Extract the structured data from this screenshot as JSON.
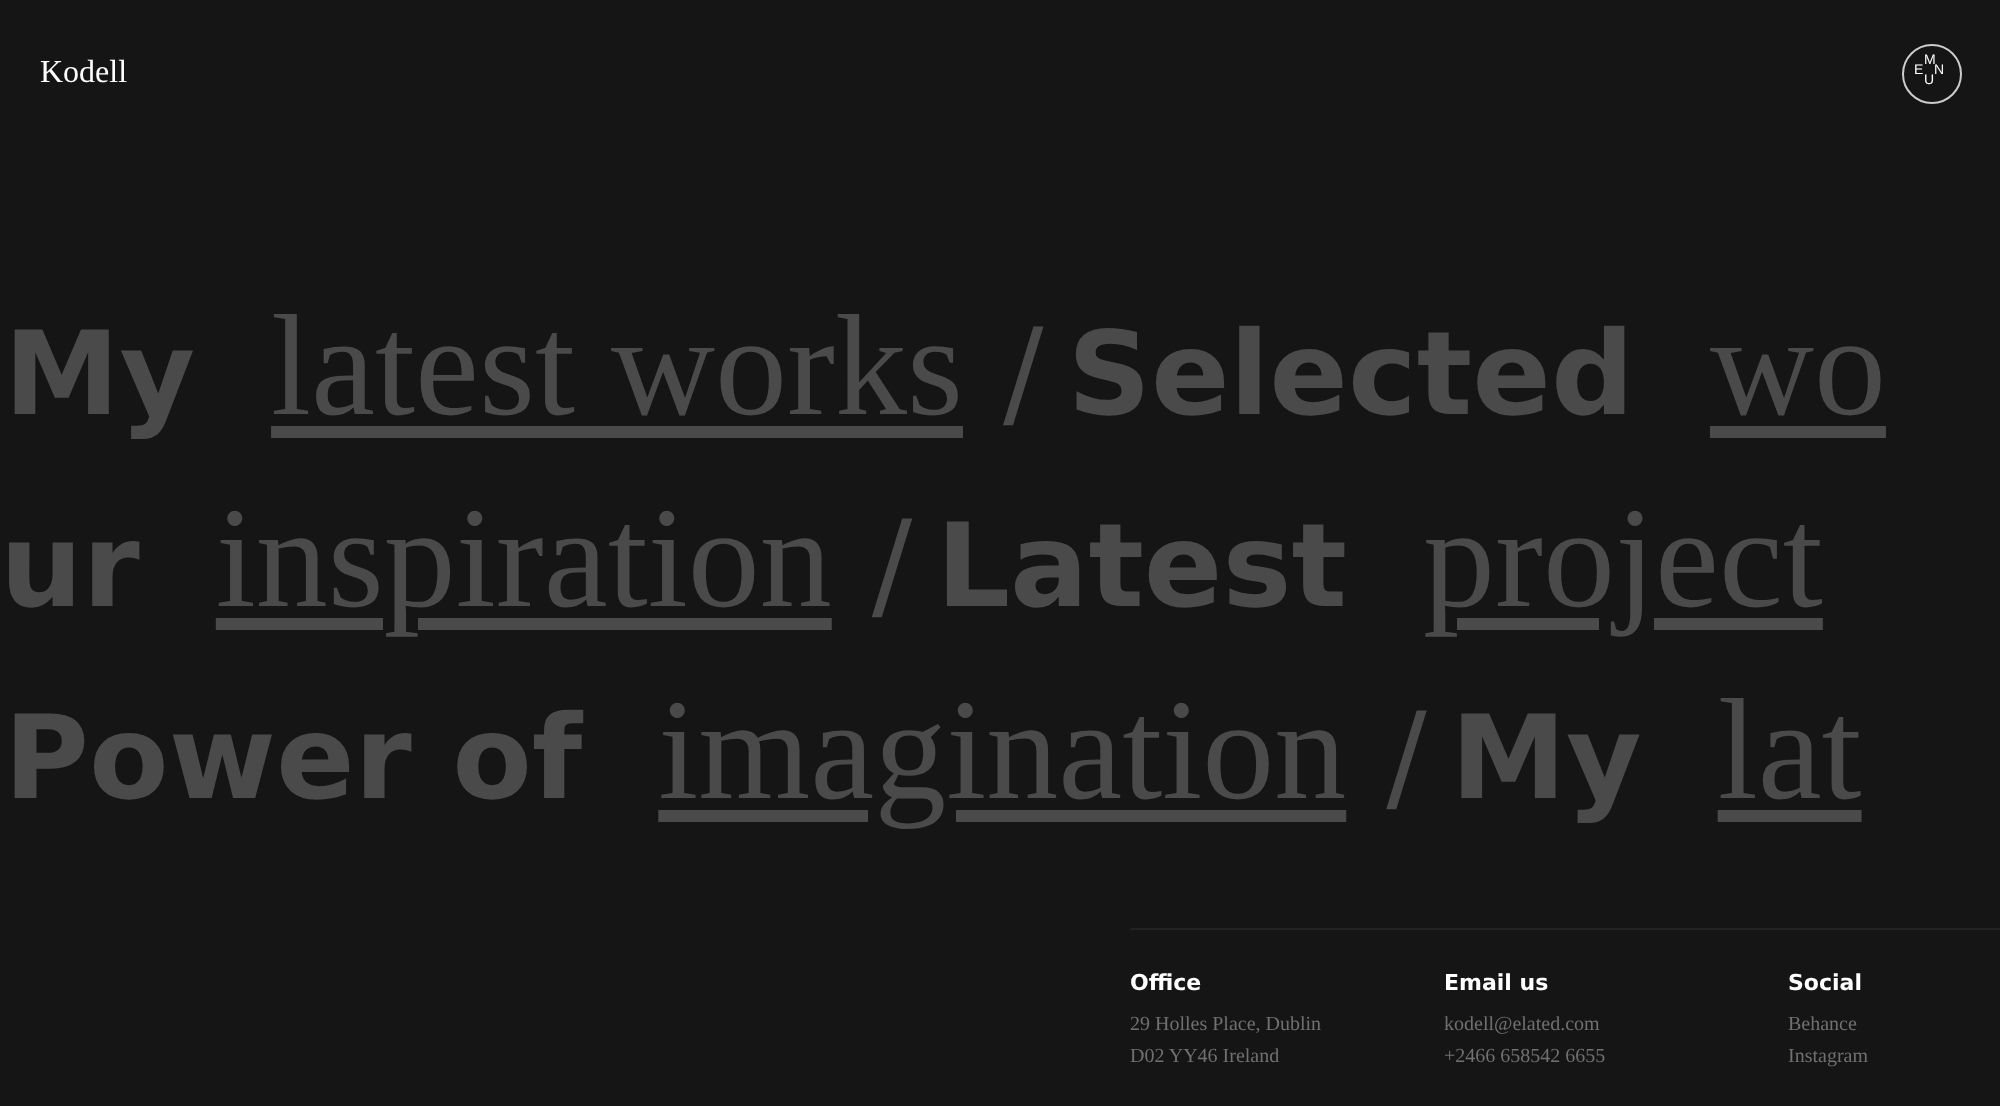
{
  "header": {
    "logo": "Kodell",
    "menu_letters": [
      "M",
      "E",
      "N",
      "U"
    ]
  },
  "marquee": [
    {
      "segments": [
        {
          "kind": "bold",
          "text": "My"
        },
        {
          "kind": "link",
          "text": "latest works"
        },
        {
          "kind": "slash",
          "text": "/"
        },
        {
          "kind": "bold",
          "text": "Selected"
        },
        {
          "kind": "link",
          "text": "wo"
        }
      ]
    },
    {
      "segments": [
        {
          "kind": "bold",
          "text": "ur"
        },
        {
          "kind": "link",
          "text": "inspiration"
        },
        {
          "kind": "slash",
          "text": "/"
        },
        {
          "kind": "bold",
          "text": "Latest"
        },
        {
          "kind": "link",
          "text": "project"
        }
      ]
    },
    {
      "segments": [
        {
          "kind": "bold",
          "text": "Power of"
        },
        {
          "kind": "link",
          "text": "imagination"
        },
        {
          "kind": "slash",
          "text": "/"
        },
        {
          "kind": "bold",
          "text": "My"
        },
        {
          "kind": "link",
          "text": "lat"
        }
      ]
    }
  ],
  "footer": {
    "columns": [
      {
        "title": "Office",
        "lines": [
          "29 Holles Place, Dublin",
          "D02 YY46 Ireland"
        ]
      },
      {
        "title": "Email us",
        "lines": [
          "kodell@elated.com",
          "+2466 658542 6655"
        ]
      },
      {
        "title": "Social",
        "lines": [
          "Behance",
          "Instagram"
        ]
      }
    ]
  }
}
